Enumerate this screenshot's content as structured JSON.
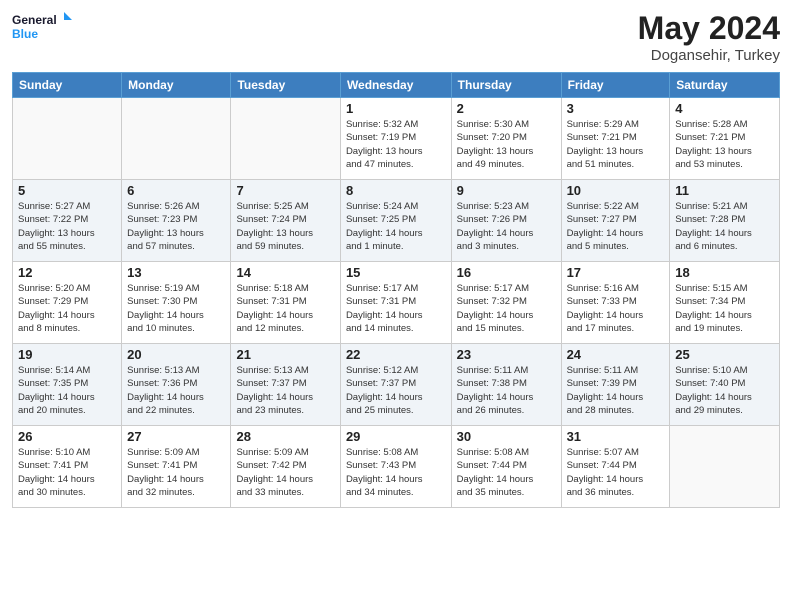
{
  "header": {
    "logo_line1": "General",
    "logo_line2": "Blue",
    "month": "May 2024",
    "location": "Dogansehir, Turkey"
  },
  "weekdays": [
    "Sunday",
    "Monday",
    "Tuesday",
    "Wednesday",
    "Thursday",
    "Friday",
    "Saturday"
  ],
  "weeks": [
    [
      {
        "day": "",
        "info": ""
      },
      {
        "day": "",
        "info": ""
      },
      {
        "day": "",
        "info": ""
      },
      {
        "day": "1",
        "info": "Sunrise: 5:32 AM\nSunset: 7:19 PM\nDaylight: 13 hours\nand 47 minutes."
      },
      {
        "day": "2",
        "info": "Sunrise: 5:30 AM\nSunset: 7:20 PM\nDaylight: 13 hours\nand 49 minutes."
      },
      {
        "day": "3",
        "info": "Sunrise: 5:29 AM\nSunset: 7:21 PM\nDaylight: 13 hours\nand 51 minutes."
      },
      {
        "day": "4",
        "info": "Sunrise: 5:28 AM\nSunset: 7:21 PM\nDaylight: 13 hours\nand 53 minutes."
      }
    ],
    [
      {
        "day": "5",
        "info": "Sunrise: 5:27 AM\nSunset: 7:22 PM\nDaylight: 13 hours\nand 55 minutes."
      },
      {
        "day": "6",
        "info": "Sunrise: 5:26 AM\nSunset: 7:23 PM\nDaylight: 13 hours\nand 57 minutes."
      },
      {
        "day": "7",
        "info": "Sunrise: 5:25 AM\nSunset: 7:24 PM\nDaylight: 13 hours\nand 59 minutes."
      },
      {
        "day": "8",
        "info": "Sunrise: 5:24 AM\nSunset: 7:25 PM\nDaylight: 14 hours\nand 1 minute."
      },
      {
        "day": "9",
        "info": "Sunrise: 5:23 AM\nSunset: 7:26 PM\nDaylight: 14 hours\nand 3 minutes."
      },
      {
        "day": "10",
        "info": "Sunrise: 5:22 AM\nSunset: 7:27 PM\nDaylight: 14 hours\nand 5 minutes."
      },
      {
        "day": "11",
        "info": "Sunrise: 5:21 AM\nSunset: 7:28 PM\nDaylight: 14 hours\nand 6 minutes."
      }
    ],
    [
      {
        "day": "12",
        "info": "Sunrise: 5:20 AM\nSunset: 7:29 PM\nDaylight: 14 hours\nand 8 minutes."
      },
      {
        "day": "13",
        "info": "Sunrise: 5:19 AM\nSunset: 7:30 PM\nDaylight: 14 hours\nand 10 minutes."
      },
      {
        "day": "14",
        "info": "Sunrise: 5:18 AM\nSunset: 7:31 PM\nDaylight: 14 hours\nand 12 minutes."
      },
      {
        "day": "15",
        "info": "Sunrise: 5:17 AM\nSunset: 7:31 PM\nDaylight: 14 hours\nand 14 minutes."
      },
      {
        "day": "16",
        "info": "Sunrise: 5:17 AM\nSunset: 7:32 PM\nDaylight: 14 hours\nand 15 minutes."
      },
      {
        "day": "17",
        "info": "Sunrise: 5:16 AM\nSunset: 7:33 PM\nDaylight: 14 hours\nand 17 minutes."
      },
      {
        "day": "18",
        "info": "Sunrise: 5:15 AM\nSunset: 7:34 PM\nDaylight: 14 hours\nand 19 minutes."
      }
    ],
    [
      {
        "day": "19",
        "info": "Sunrise: 5:14 AM\nSunset: 7:35 PM\nDaylight: 14 hours\nand 20 minutes."
      },
      {
        "day": "20",
        "info": "Sunrise: 5:13 AM\nSunset: 7:36 PM\nDaylight: 14 hours\nand 22 minutes."
      },
      {
        "day": "21",
        "info": "Sunrise: 5:13 AM\nSunset: 7:37 PM\nDaylight: 14 hours\nand 23 minutes."
      },
      {
        "day": "22",
        "info": "Sunrise: 5:12 AM\nSunset: 7:37 PM\nDaylight: 14 hours\nand 25 minutes."
      },
      {
        "day": "23",
        "info": "Sunrise: 5:11 AM\nSunset: 7:38 PM\nDaylight: 14 hours\nand 26 minutes."
      },
      {
        "day": "24",
        "info": "Sunrise: 5:11 AM\nSunset: 7:39 PM\nDaylight: 14 hours\nand 28 minutes."
      },
      {
        "day": "25",
        "info": "Sunrise: 5:10 AM\nSunset: 7:40 PM\nDaylight: 14 hours\nand 29 minutes."
      }
    ],
    [
      {
        "day": "26",
        "info": "Sunrise: 5:10 AM\nSunset: 7:41 PM\nDaylight: 14 hours\nand 30 minutes."
      },
      {
        "day": "27",
        "info": "Sunrise: 5:09 AM\nSunset: 7:41 PM\nDaylight: 14 hours\nand 32 minutes."
      },
      {
        "day": "28",
        "info": "Sunrise: 5:09 AM\nSunset: 7:42 PM\nDaylight: 14 hours\nand 33 minutes."
      },
      {
        "day": "29",
        "info": "Sunrise: 5:08 AM\nSunset: 7:43 PM\nDaylight: 14 hours\nand 34 minutes."
      },
      {
        "day": "30",
        "info": "Sunrise: 5:08 AM\nSunset: 7:44 PM\nDaylight: 14 hours\nand 35 minutes."
      },
      {
        "day": "31",
        "info": "Sunrise: 5:07 AM\nSunset: 7:44 PM\nDaylight: 14 hours\nand 36 minutes."
      },
      {
        "day": "",
        "info": ""
      }
    ]
  ]
}
